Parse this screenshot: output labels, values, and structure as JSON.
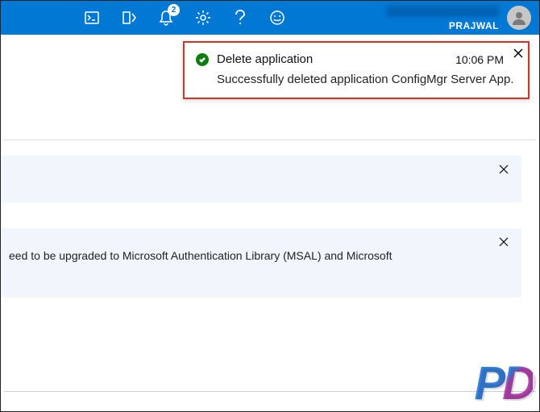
{
  "topbar": {
    "notification_count": "2",
    "username": "PRAJWAL"
  },
  "toast": {
    "title": "Delete application",
    "time": "10:06 PM",
    "message": "Successfully deleted application ConfigMgr Server App."
  },
  "banner2": {
    "text": "eed to be upgraded to Microsoft Authentication Library (MSAL) and Microsoft"
  },
  "watermark": "PD"
}
